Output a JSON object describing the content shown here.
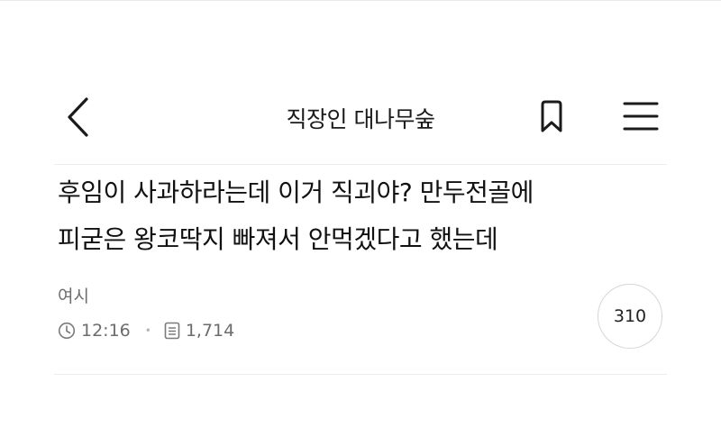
{
  "header": {
    "title": "직장인 대나무숲",
    "back_icon": "chevron-left-icon",
    "bookmark_icon": "bookmark-icon",
    "menu_icon": "hamburger-menu-icon"
  },
  "post": {
    "title_line1": "후임이 사과하라는데 이거 직괴야? 만두전골에",
    "title_line2": "피굳은 왕코딱지 빠져서 안먹겠다고 했는데",
    "author": "여시",
    "time": "12:16",
    "views": "1,714",
    "comment_count": "310"
  }
}
